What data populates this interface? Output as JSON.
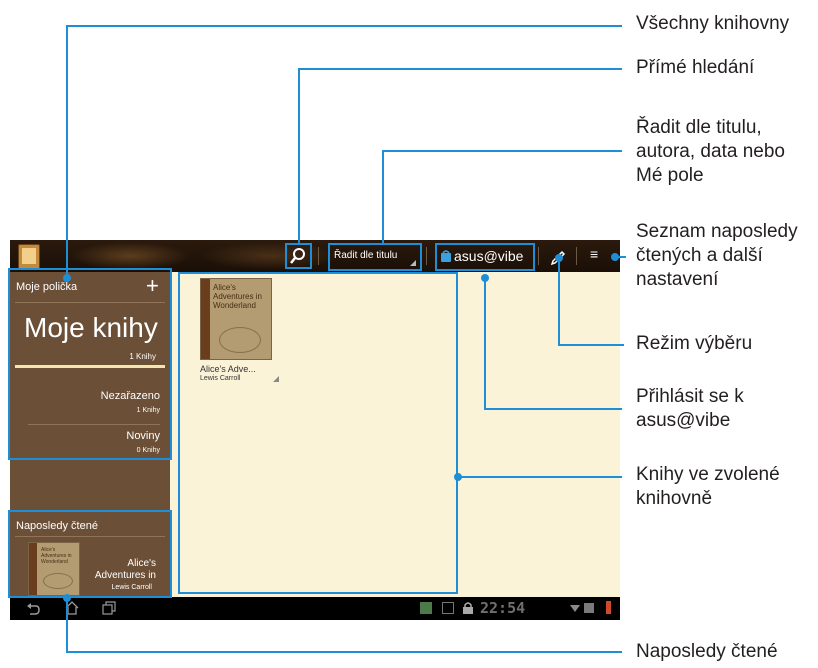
{
  "topbar": {
    "sort_label": "Řadit dle titulu",
    "asus_vibe_label": "asus@vibe",
    "menu_glyph": "≡"
  },
  "sidebar": {
    "my_shelves": "Moje polička",
    "add_glyph": "+",
    "my_books_title": "Moje knihy",
    "my_books_count": "1 Knihy",
    "shelves": [
      {
        "name": "Nezařazeno",
        "count": "1 Knihy"
      },
      {
        "name": "Noviny",
        "count": "0 Knihy"
      }
    ],
    "recently_read_title": "Naposledy čtené",
    "recent_book": {
      "cover_title": "Alice's Adventures in Wonderland",
      "title": "Alice's Adventures in",
      "author": "Lewis Carroll"
    }
  },
  "main": {
    "book": {
      "cover_title": "Alice's Adventures in Wonderland",
      "title": "Alice's Adve...",
      "author": "Lewis Carroll"
    }
  },
  "statusbar": {
    "time": "22:54"
  },
  "annotations": {
    "all_libraries": "Všechny knihovny",
    "direct_search": "Přímé hledání",
    "sort_info": [
      "Řadit dle titulu,",
      "autora, data nebo",
      "Mé pole"
    ],
    "recent_settings": [
      "Seznam naposledy",
      "čtených a další",
      "nastavení"
    ],
    "select_mode": "Režim výběru",
    "login_vibe": [
      "Přihlásit se k",
      "asus@vibe"
    ],
    "books_in_library": [
      "Knihy ve zvolené",
      "knihovně"
    ],
    "recently_read": "Naposledy čtené"
  },
  "colors": {
    "callout": "#1e8fd6",
    "sidebar": "#6b4f36",
    "content": "#fbf3d8",
    "topbar": "#1f140a"
  },
  "icons": [
    "app-icon",
    "search-icon",
    "sort-dropdown-icon",
    "asus-vibe-icon",
    "pencil-icon",
    "menu-icon",
    "plus-icon",
    "back-icon",
    "home-icon",
    "recent-apps-icon",
    "gallery-icon",
    "download-icon",
    "lock-icon",
    "wifi-icon",
    "battery-icon"
  ]
}
